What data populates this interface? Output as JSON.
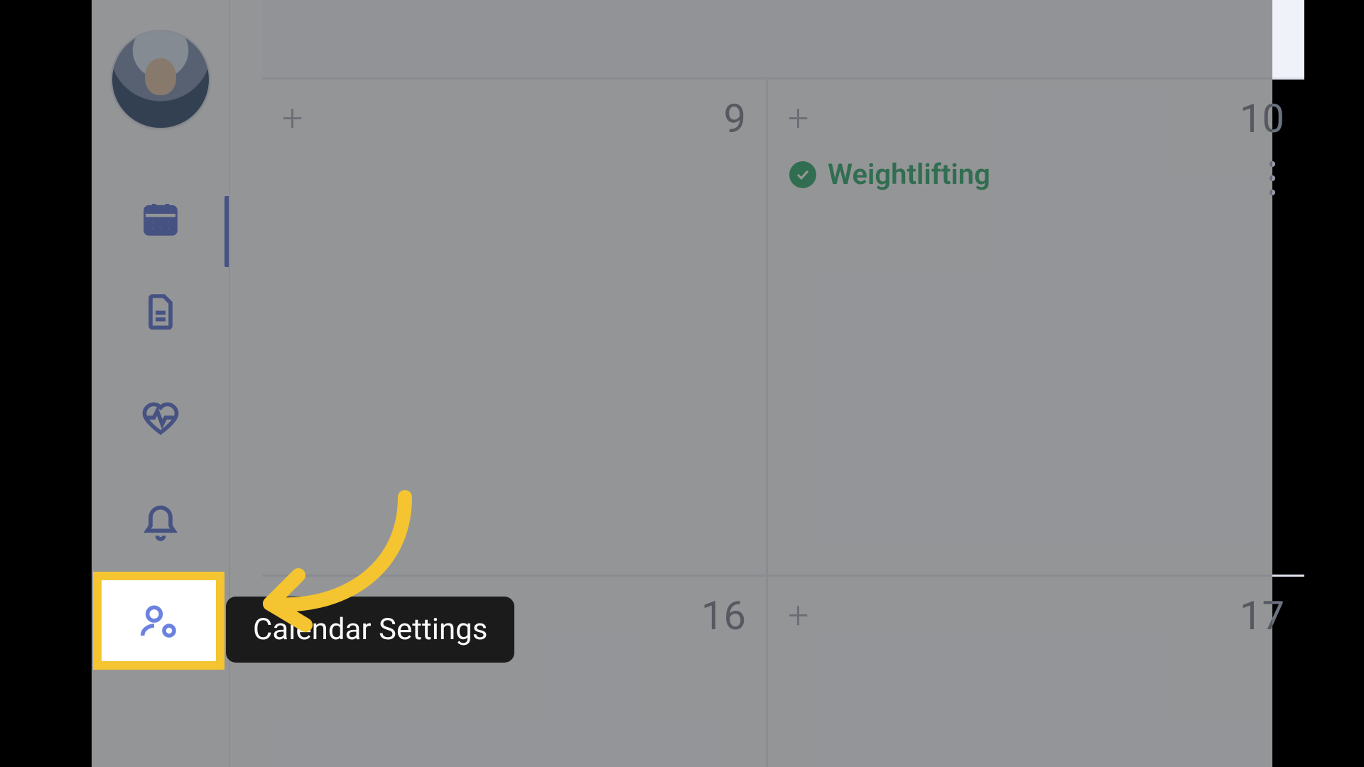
{
  "sidebar": {
    "items": {
      "calendar": {
        "name": "calendar-nav"
      },
      "documents": {
        "name": "documents-nav"
      },
      "heart": {
        "name": "health-nav"
      },
      "bell": {
        "name": "notifications-nav"
      },
      "settings": {
        "name": "calendar-settings-nav"
      }
    }
  },
  "tooltip": {
    "text": "Calendar Settings"
  },
  "calendar": {
    "days": {
      "c9": {
        "number": "9"
      },
      "c10": {
        "number": "10"
      },
      "c16": {
        "number": "16"
      },
      "c17": {
        "number": "17"
      }
    },
    "events": {
      "e1": {
        "title": "Weightlifting",
        "status": "completed",
        "color": "#1aa05f"
      }
    }
  },
  "annotation": {
    "highlight_color": "#f4c431"
  }
}
